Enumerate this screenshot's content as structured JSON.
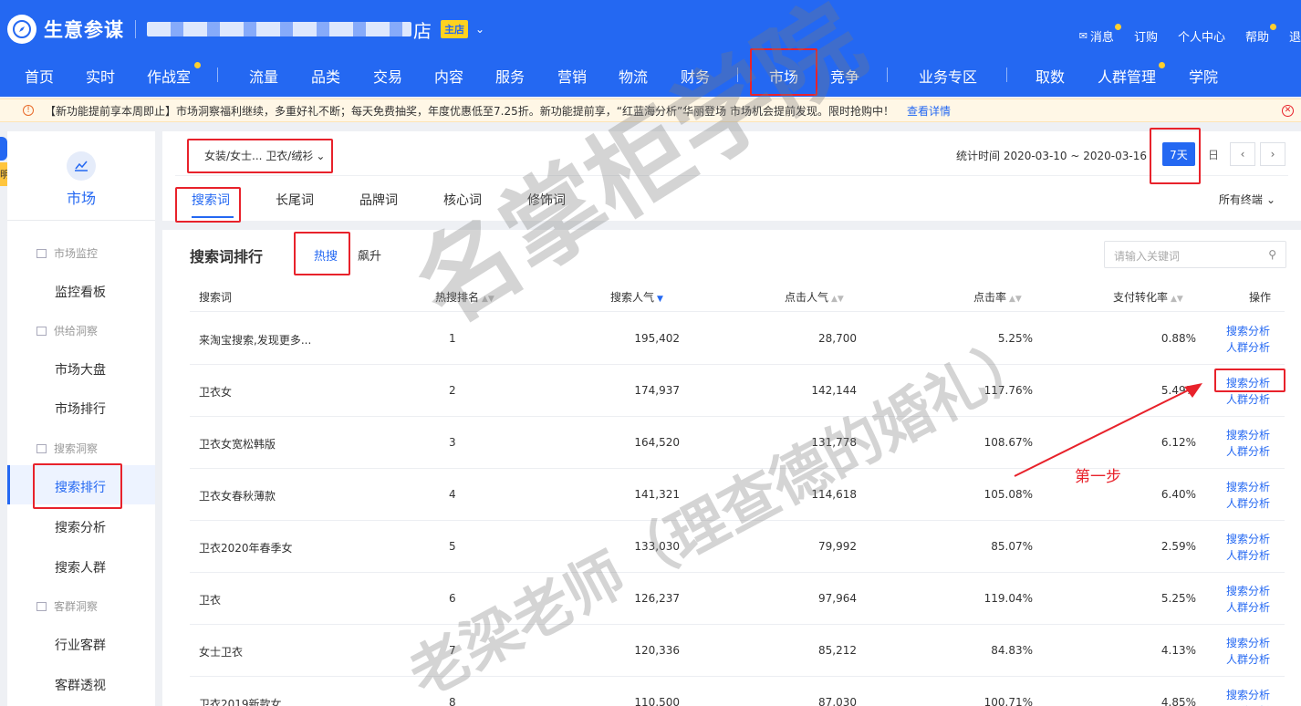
{
  "header": {
    "app_name": "生意参谋",
    "shop_suffix": "店",
    "shop_badge": "主店",
    "top_links": [
      {
        "label": "消息",
        "dot": true
      },
      {
        "label": "订购",
        "dot": false
      },
      {
        "label": "个人中心",
        "dot": false
      },
      {
        "label": "帮助",
        "dot": true
      },
      {
        "label": "退",
        "dot": false
      }
    ]
  },
  "nav": {
    "items": [
      "首页",
      "实时",
      "作战室",
      "流量",
      "品类",
      "交易",
      "内容",
      "服务",
      "营销",
      "物流",
      "财务",
      "市场",
      "竞争",
      "业务专区",
      "取数",
      "人群管理",
      "学院"
    ]
  },
  "notice": {
    "text": "【新功能提前享本周即止】市场洞察福利继续，多重好礼不断；每天免费抽奖，年度优惠低至7.25折。新功能提前享，“红蓝海分析”华丽登场 市场机会提前发现。限时抢购中！",
    "link": "查看详情"
  },
  "sidebar": {
    "title": "市场",
    "tip": "明",
    "groups": [
      {
        "label": "市场监控",
        "items": [
          "监控看板"
        ]
      },
      {
        "label": "供给洞察",
        "items": [
          "市场大盘",
          "市场排行"
        ]
      },
      {
        "label": "搜索洞察",
        "items": [
          "搜索排行",
          "搜索分析",
          "搜索人群"
        ]
      },
      {
        "label": "客群洞察",
        "items": [
          "行业客群",
          "客群透视"
        ]
      }
    ],
    "active": "搜索排行"
  },
  "filter": {
    "category": "女装/女士... 卫衣/绒衫",
    "stat_time": "统计时间 2020-03-10 ~ 2020-03-16",
    "period_active": "7天",
    "period_day": "日",
    "tabs": [
      "搜索词",
      "长尾词",
      "品牌词",
      "核心词",
      "修饰词"
    ],
    "devices": "所有终端"
  },
  "ranking": {
    "title": "搜索词排行",
    "subtabs": [
      "热搜",
      "飙升"
    ],
    "search_placeholder": "请输入关键词",
    "columns": [
      "搜索词",
      "热搜排名",
      "搜索人气",
      "点击人气",
      "点击率",
      "支付转化率",
      "操作"
    ],
    "op_labels": [
      "搜索分析",
      "人群分析"
    ],
    "rows": [
      {
        "term": "来淘宝搜索,发现更多...",
        "rank": "1",
        "search_pop": "195,402",
        "click_pop": "28,700",
        "ctr": "5.25%",
        "cvr": "0.88%"
      },
      {
        "term": "卫衣女",
        "rank": "2",
        "search_pop": "174,937",
        "click_pop": "142,144",
        "ctr": "117.76%",
        "cvr": "5.49%"
      },
      {
        "term": "卫衣女宽松韩版",
        "rank": "3",
        "search_pop": "164,520",
        "click_pop": "131,778",
        "ctr": "108.67%",
        "cvr": "6.12%"
      },
      {
        "term": "卫衣女春秋薄款",
        "rank": "4",
        "search_pop": "141,321",
        "click_pop": "114,618",
        "ctr": "105.08%",
        "cvr": "6.40%"
      },
      {
        "term": "卫衣2020年春季女",
        "rank": "5",
        "search_pop": "133,030",
        "click_pop": "79,992",
        "ctr": "85.07%",
        "cvr": "2.59%"
      },
      {
        "term": "卫衣",
        "rank": "6",
        "search_pop": "126,237",
        "click_pop": "97,964",
        "ctr": "119.04%",
        "cvr": "5.25%"
      },
      {
        "term": "女士卫衣",
        "rank": "7",
        "search_pop": "120,336",
        "click_pop": "85,212",
        "ctr": "84.83%",
        "cvr": "4.13%"
      },
      {
        "term": "卫衣2019新款女",
        "rank": "8",
        "search_pop": "110,500",
        "click_pop": "87,030",
        "ctr": "100.71%",
        "cvr": "4.85%"
      }
    ]
  },
  "annotation": {
    "step_label": "第一步",
    "watermark_1": "名掌柜学院",
    "watermark_2": "老梁老师（理查德的婚礼）"
  },
  "colors": {
    "primary": "#2468f2",
    "highlight": "#e8222b",
    "badge": "#ffd21f"
  }
}
